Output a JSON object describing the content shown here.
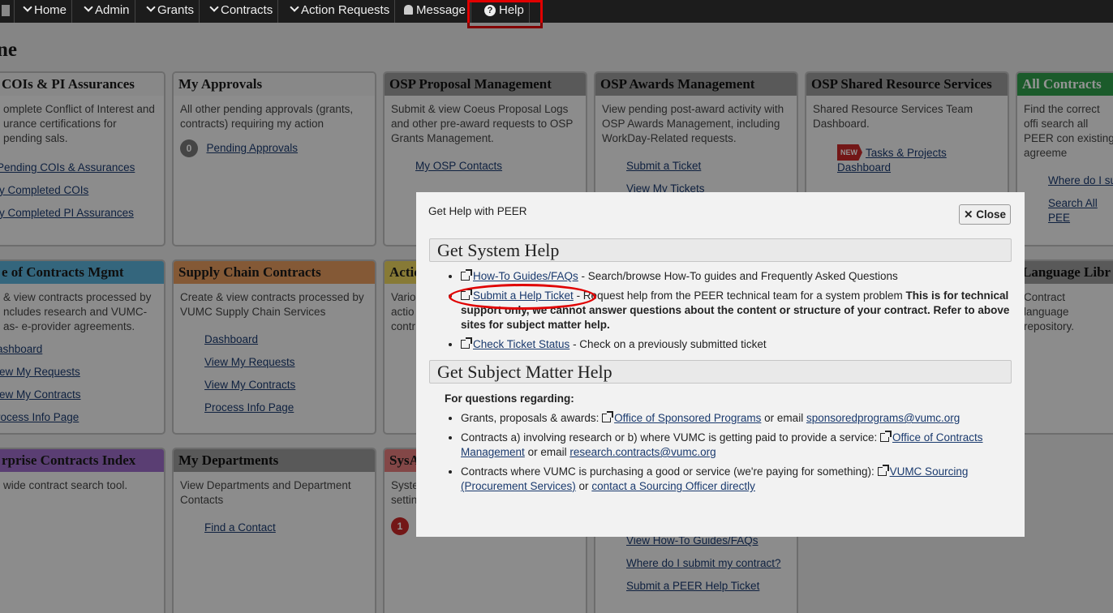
{
  "nav": {
    "items": [
      {
        "label": "Home",
        "chevron": true
      },
      {
        "label": "Admin",
        "chevron": true
      },
      {
        "label": "Grants",
        "chevron": true
      },
      {
        "label": "Contracts",
        "chevron": true
      },
      {
        "label": "Action Requests",
        "chevron": true
      },
      {
        "label": "Message",
        "icon": "bell-icon"
      },
      {
        "label": "Help",
        "icon": "question-circle-icon"
      }
    ]
  },
  "page": {
    "title": "ne"
  },
  "cards": {
    "cois": {
      "title": "COIs & PI Assurances",
      "desc": "omplete Conflict of Interest and urance certifications for pending sals.",
      "links": [
        "Pending COIs & Assurances",
        "ly Completed COIs",
        "ly Completed PI Assurances"
      ]
    },
    "approvals": {
      "title": "My Approvals",
      "desc": "All other pending approvals (grants, contracts) requiring my action",
      "badge": "0",
      "link": "Pending Approvals"
    },
    "osp_proposal": {
      "title": "OSP Proposal Management",
      "desc": "Submit & view Coeus Proposal Logs and other pre-award requests to OSP Grants Management.",
      "link": "My OSP Contacts"
    },
    "osp_awards": {
      "title": "OSP Awards Management",
      "desc": "View pending post-award activity with OSP Awards Management, including WorkDay-Related requests.",
      "links": [
        "Submit a Ticket",
        "View My Tickets"
      ]
    },
    "shared": {
      "title": "OSP Shared Resource Services",
      "desc": "Shared Resource Services Team Dashboard.",
      "new_tag": "NEW",
      "link": "Tasks & Projects Dashboard"
    },
    "all_contracts": {
      "title": "All Contracts",
      "desc": "Find the correct offi search all PEER con existing agreeme",
      "links": [
        "Where do I su",
        "Search All PEE"
      ]
    },
    "contracts_mgmt": {
      "title": "e of Contracts Mgmt",
      "desc": "& view contracts processed by ncludes research and VUMC-as- e-provider agreements.",
      "links": [
        "ashboard",
        "iew My Requests",
        "iew My Contracts",
        "rocess Info Page"
      ]
    },
    "supply": {
      "title": "Supply Chain Contracts",
      "desc": "Create & view contracts processed by VUMC Supply Chain Services",
      "links": [
        "Dashboard",
        "View My Requests",
        "View My Contracts",
        "Process Info Page"
      ]
    },
    "action": {
      "title": "Actio",
      "desc": "Vario actio contr"
    },
    "language": {
      "title": "Language Libr",
      "desc": "Contract language repository."
    },
    "enterprise": {
      "title": "rprise Contracts Index",
      "desc": "wide contract search tool."
    },
    "departments": {
      "title": "My Departments",
      "desc": "View Departments and Department Contacts",
      "link": "Find a Contact"
    },
    "sysadmin": {
      "title": "SysA",
      "desc": "Syste settin",
      "badge": "1"
    },
    "help_card": {
      "links": [
        "View How-To Guides/FAQs",
        "Where do I submit my contract?",
        "Submit a PEER Help Ticket"
      ]
    }
  },
  "modal": {
    "title": "Get Help with PEER",
    "close_label": "Close",
    "system_help": {
      "heading": "Get System Help",
      "items": [
        {
          "link": "How-To Guides/FAQs",
          "text": " - Search/browse How-To guides and Frequently Asked Questions",
          "bold": ""
        },
        {
          "link": "Submit a Help Ticket",
          "text": " - Request help from the PEER technical team for a system problem ",
          "bold": "This is for technical support only, we cannot answer questions about the content or structure of your contract. Refer to above sites for subject matter help."
        },
        {
          "link": "Check Ticket Status",
          "text": " - Check on a previously submitted ticket",
          "bold": ""
        }
      ]
    },
    "subject_help": {
      "heading": "Get Subject Matter Help",
      "intro": "For questions regarding:",
      "items": [
        {
          "pre": "Grants, proposals & awards: ",
          "link": "Office of Sponsored Programs",
          "mid": " or email ",
          "link2": "sponsoredprograms@vumc.org"
        },
        {
          "pre": "Contracts a) involving research or b) where VUMC is getting paid to provide a service: ",
          "link": "Office of Contracts Management",
          "mid": " or email ",
          "link2": "research.contracts@vumc.org"
        },
        {
          "pre": "Contracts where VUMC is purchasing a good or service (we're paying for something): ",
          "link": "VUMC Sourcing (Procurement Services)",
          "mid": " or ",
          "link2": "contact a Sourcing Officer directly"
        }
      ]
    }
  },
  "colors": {
    "highlight": "#e00000",
    "nav_bg": "#1c1c1c",
    "link": "#1a3a6e"
  }
}
